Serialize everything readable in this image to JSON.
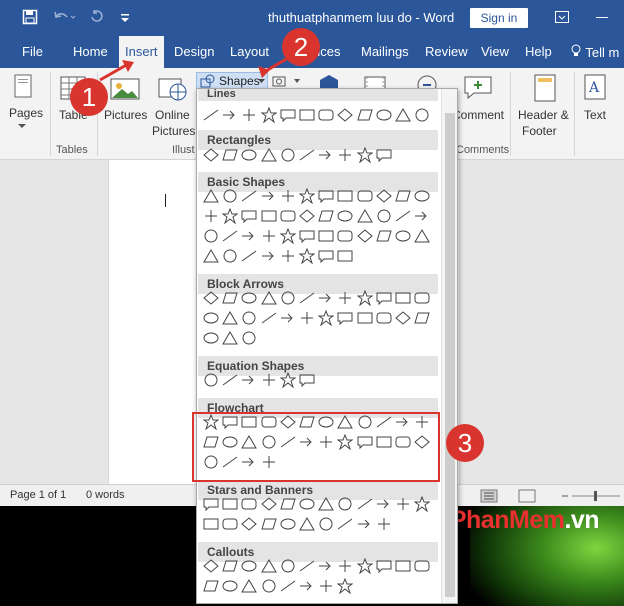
{
  "window": {
    "title": "thuthuatphanmem luu do - Word",
    "signin_label": "Sign in",
    "quick_access": [
      "save-icon",
      "undo-icon",
      "redo-icon",
      "customize-icon"
    ]
  },
  "tabs": [
    {
      "label": "File"
    },
    {
      "label": "Home"
    },
    {
      "label": "Insert",
      "active": true
    },
    {
      "label": "Design"
    },
    {
      "label": "Layout"
    },
    {
      "label": "nces"
    },
    {
      "label": "Mailings"
    },
    {
      "label": "Review"
    },
    {
      "label": "View"
    },
    {
      "label": "Help"
    },
    {
      "label": "Tell m"
    }
  ],
  "ribbon": {
    "pages": "Pages",
    "table": "Table",
    "pictures": "Pictures",
    "online_pictures": [
      "Online",
      "Pictures"
    ],
    "shapes": "Shapes",
    "comment": "Comment",
    "header_footer": [
      "Header &",
      "Footer"
    ],
    "text": "Text",
    "groups": {
      "tables": "Tables",
      "illustrations": "Illust",
      "comments": "Comments"
    }
  },
  "gallery": {
    "sections": [
      {
        "title": "Lines"
      },
      {
        "title": "Rectangles"
      },
      {
        "title": "Basic Shapes"
      },
      {
        "title": "Block Arrows"
      },
      {
        "title": "Equation Shapes"
      },
      {
        "title": "Flowchart"
      },
      {
        "title": "Stars and Banners"
      },
      {
        "title": "Callouts"
      }
    ]
  },
  "status": {
    "page": "Page 1 of 1",
    "words": "0 words"
  },
  "annotations": {
    "step1": "1",
    "step2": "2",
    "step3": "3"
  },
  "watermark": {
    "main": "ThuThuatPhanMem",
    "suffix": ".vn"
  },
  "colors": {
    "brand": "#2b579a",
    "annotation": "#d9352e"
  }
}
